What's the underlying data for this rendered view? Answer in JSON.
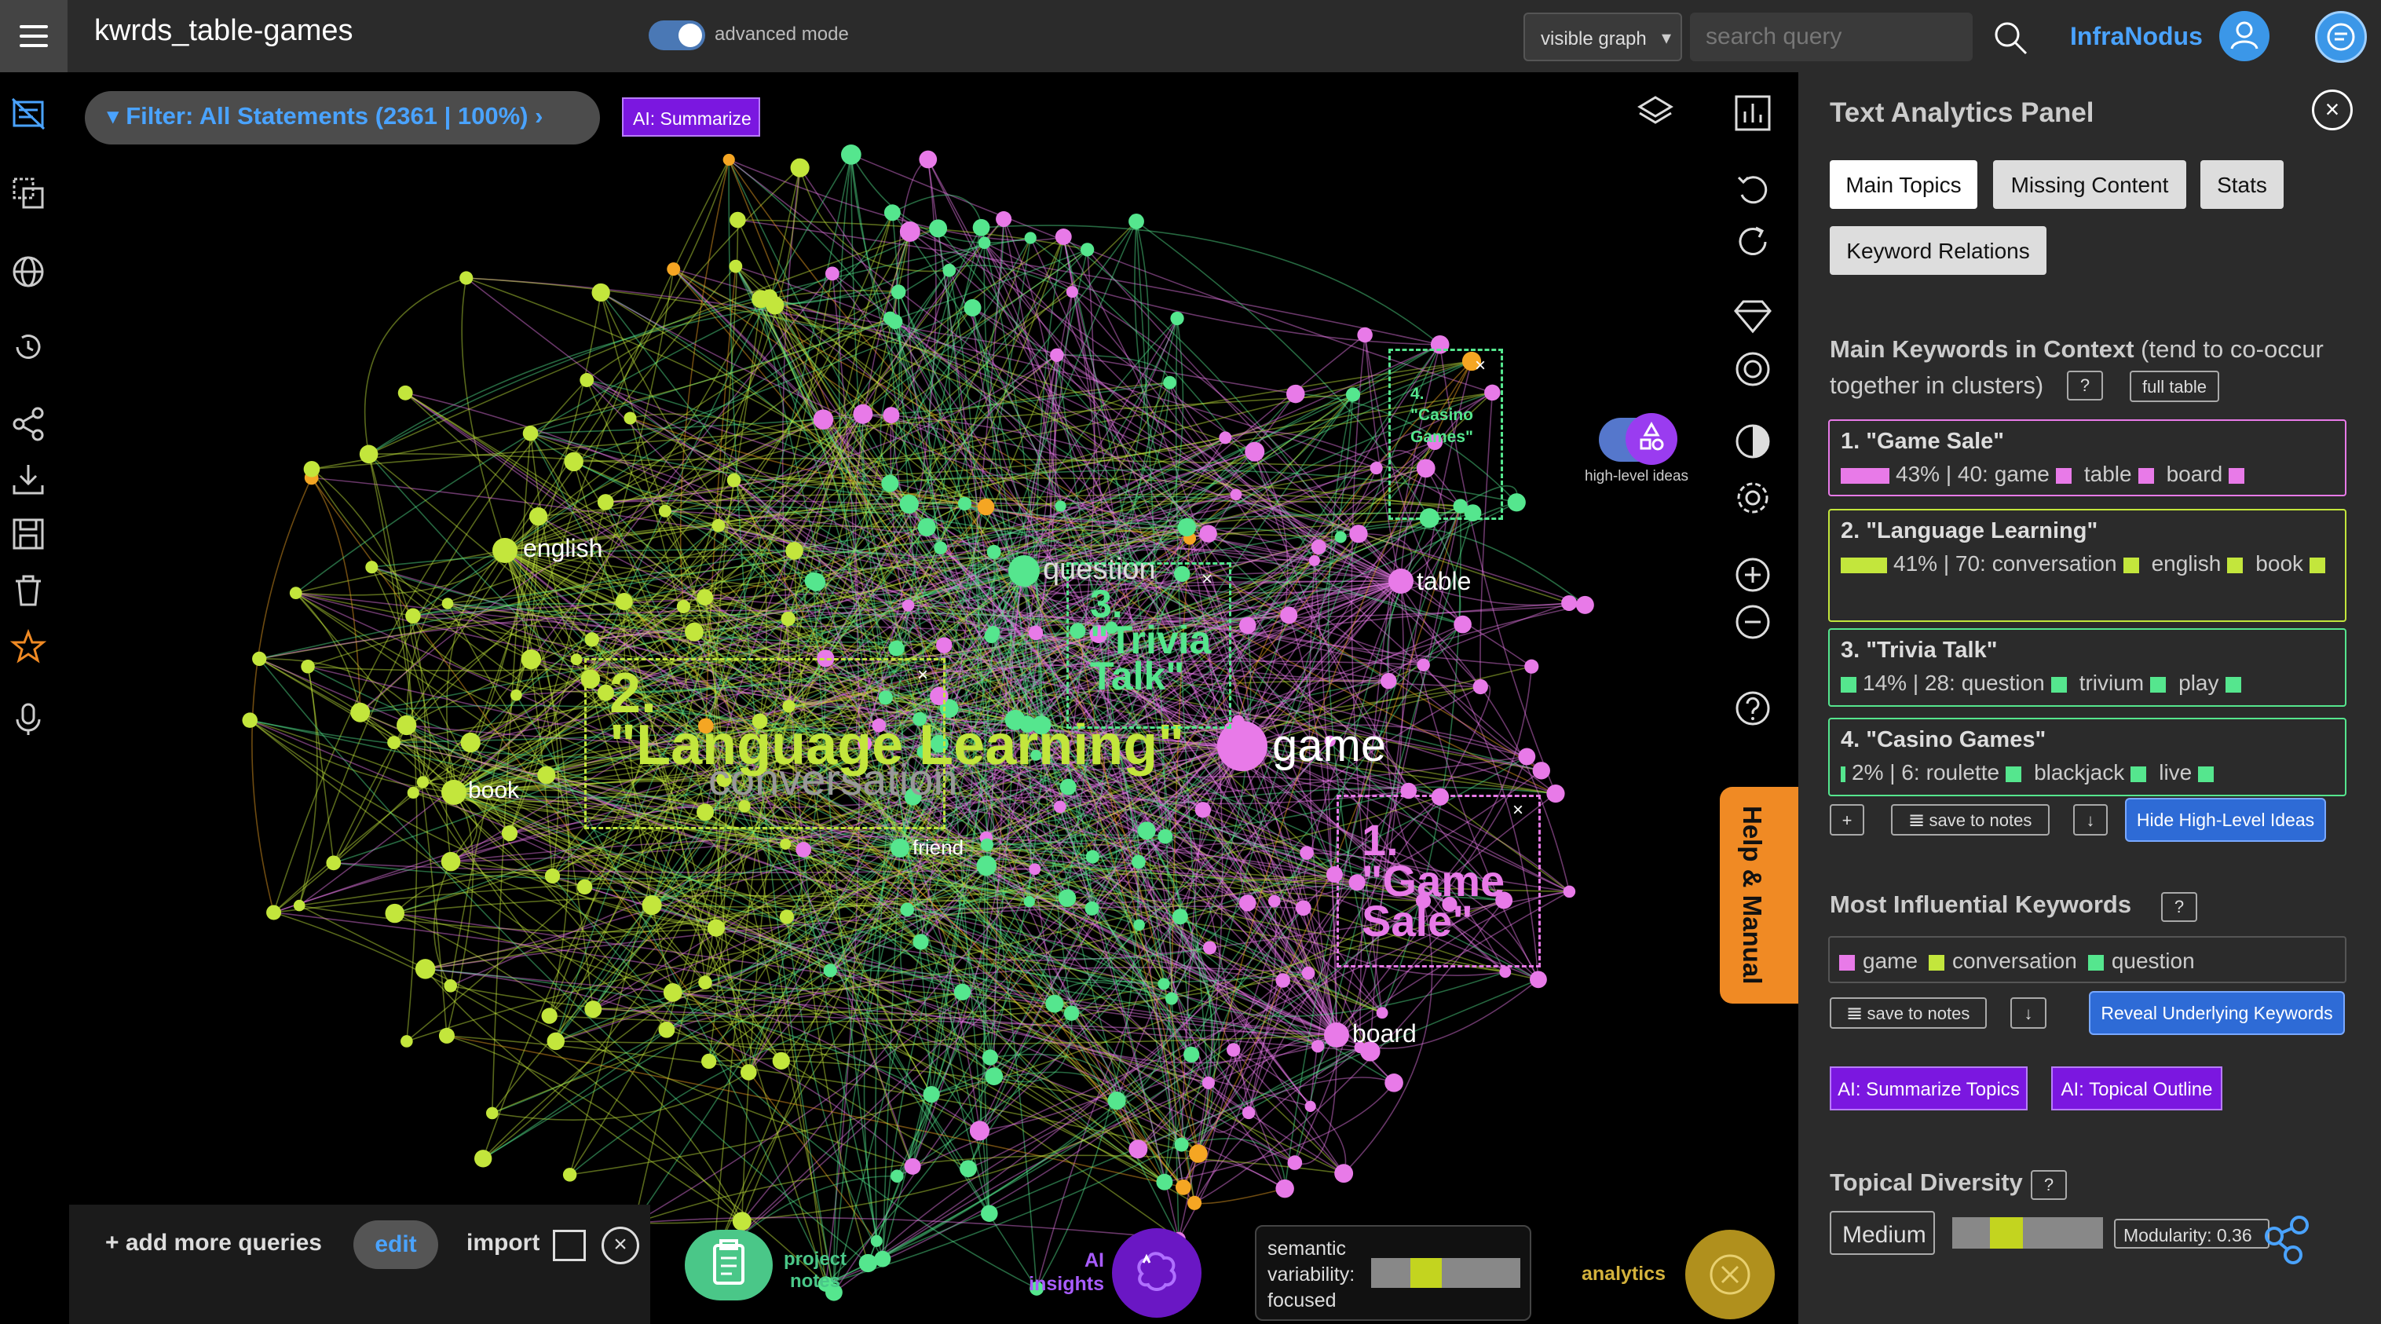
{
  "header": {
    "title": "kwrds_table-games",
    "advanced_mode_label": "advanced mode",
    "graph_select": "visible graph",
    "search_placeholder": "search query",
    "brand": "InfraNodus"
  },
  "filter": {
    "label": "Filter: All Statements (2361 | 100%)",
    "ai_summarize": "AI: Summarize"
  },
  "graph": {
    "labels": {
      "english": "english",
      "book": "book",
      "question": "question",
      "table": "table",
      "game": "game",
      "friend": "friend",
      "board": "board",
      "conversation": "conversation"
    },
    "topics": [
      {
        "number": "2.",
        "name": "\"Language Learning\""
      },
      {
        "number": "3.",
        "name": "\"Trivia Talk\""
      },
      {
        "number": "1.",
        "name": "\"Game Sale\""
      },
      {
        "number": "4.",
        "name": "\"Casino Games\""
      }
    ],
    "close_glyph": "×",
    "high_level_ideas_label": "high-level ideas",
    "colors": {
      "green_cluster": "#c3e63c",
      "teal_cluster": "#55e68e",
      "pink_cluster": "#e87ae8",
      "orange_node": "#f5a623"
    }
  },
  "help_tab": "Help & Manual",
  "panel": {
    "title": "Text Analytics Panel",
    "close_glyph": "×",
    "tabs": {
      "main_topics": "Main Topics",
      "missing_content": "Missing Content",
      "stats": "Stats",
      "keyword_relations": "Keyword Relations"
    },
    "keywords_section": {
      "title": "Main Keywords in Context",
      "note": " (tend to co-occur together in clusters)",
      "help": "?",
      "full_table": "full table"
    },
    "topic_cards": [
      {
        "title": "1. \"Game Sale\"",
        "stats": "43% | 40:",
        "keywords": [
          "game",
          "table",
          "board"
        ],
        "percent": 43,
        "color": "#e87ae8"
      },
      {
        "title": "2. \"Language Learning\"",
        "stats": "41% | 70:",
        "keywords": [
          "conversation",
          "english",
          "book"
        ],
        "percent": 41,
        "color": "#c3e63c"
      },
      {
        "title": "3. \"Trivia Talk\"",
        "stats": "14% | 28:",
        "keywords": [
          "question",
          "trivium",
          "play"
        ],
        "percent": 14,
        "color": "#55e68e"
      },
      {
        "title": "4. \"Casino Games\"",
        "stats": "2% | 6:",
        "keywords": [
          "roulette",
          "blackjack",
          "live"
        ],
        "percent": 2,
        "color": "#55e68e"
      }
    ],
    "card_actions": {
      "plus": "+",
      "save_to_notes": "𝌆 save to notes",
      "download": "↓",
      "hide_high_level": "Hide High-Level Ideas"
    },
    "influential": {
      "title": "Most Influential Keywords",
      "help": "?",
      "keywords": [
        "game",
        "conversation",
        "question"
      ],
      "save_to_notes": "𝌆 save to notes",
      "download": "↓",
      "reveal": "Reveal Underlying Keywords"
    },
    "ai_buttons": {
      "summarize_topics": "AI: Summarize Topics",
      "topical_outline": "AI: Topical Outline"
    },
    "diversity": {
      "title": "Topical Diversity",
      "help": "?",
      "value": "Medium",
      "modularity": "Modularity: 0.36"
    }
  },
  "bottom": {
    "add_queries": "+ add more queries",
    "edit": "edit",
    "import": "import",
    "close_glyph": "×",
    "project_notes": "project notes",
    "ai_insights": "AI insights",
    "semantic_variability": "semantic variability: focused",
    "analytics": "analytics"
  }
}
